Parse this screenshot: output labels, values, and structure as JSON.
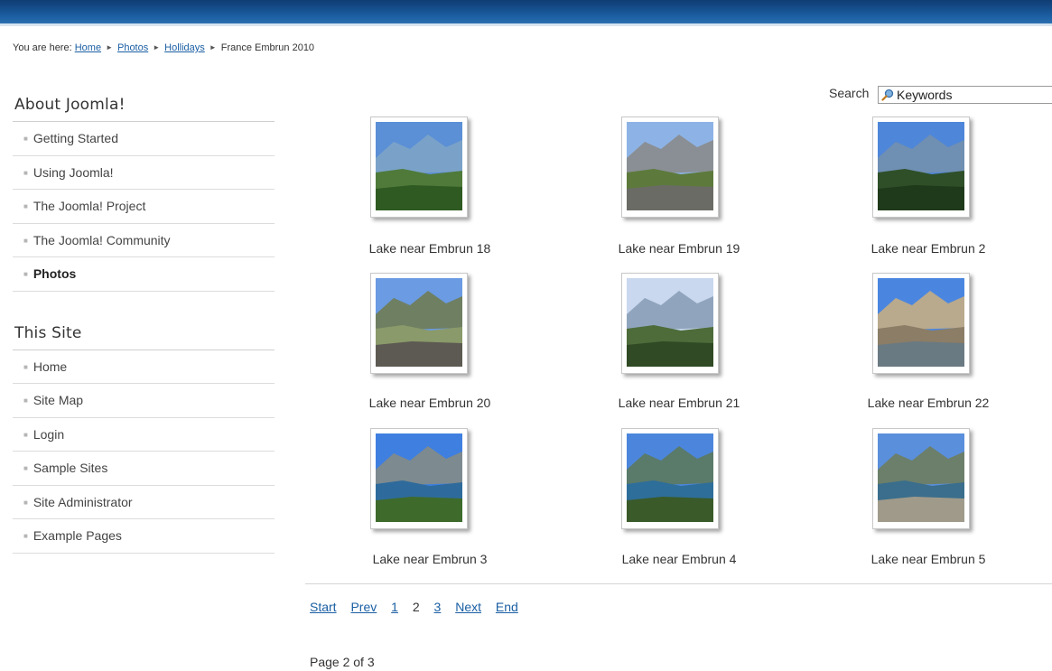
{
  "breadcrumb": {
    "prefix": "You are here:",
    "home": "Home",
    "photos": "Photos",
    "hollidays": "Hollidays",
    "current": "France Embrun 2010"
  },
  "menu_about": {
    "title": "About Joomla!",
    "items": [
      "Getting Started",
      "Using Joomla!",
      "The Joomla! Project",
      "The Joomla! Community",
      "Photos"
    ],
    "active_item": "Photos"
  },
  "menu_site": {
    "title": "This Site",
    "items": [
      "Home",
      "Site Map",
      "Login",
      "Sample Sites",
      "Site Administrator",
      "Example Pages"
    ]
  },
  "search": {
    "label": "Search",
    "placeholder": "Keywords"
  },
  "gallery": {
    "photos": [
      {
        "caption": "Lake near Embrun 18",
        "palette": [
          "#5b8fd6",
          "#7aa2c9",
          "#4f7a3a",
          "#2f5a22"
        ]
      },
      {
        "caption": "Lake near Embrun 19",
        "palette": [
          "#8db3e6",
          "#8a8f95",
          "#5d7a3c",
          "#6b6b66"
        ]
      },
      {
        "caption": "Lake near Embrun 2",
        "palette": [
          "#4e86d9",
          "#6f8fb3",
          "#2f4f28",
          "#1f3a1a"
        ]
      },
      {
        "caption": "Lake near Embrun 20",
        "palette": [
          "#6a9be3",
          "#6f7f62",
          "#8a9a6a",
          "#5c5a52"
        ]
      },
      {
        "caption": "Lake near Embrun 21",
        "palette": [
          "#c9d8ee",
          "#90a5bd",
          "#4d6c3a",
          "#2f4a24"
        ]
      },
      {
        "caption": "Lake near Embrun 22",
        "palette": [
          "#4a86e0",
          "#b9a98d",
          "#8b7d66",
          "#6a7a82"
        ]
      },
      {
        "caption": "Lake near Embrun 3",
        "palette": [
          "#3f7fe0",
          "#7d8a8f",
          "#2e6b9c",
          "#3e6a2c"
        ]
      },
      {
        "caption": "Lake near Embrun 4",
        "palette": [
          "#4c86dc",
          "#5a7a6a",
          "#2e6e9a",
          "#3a5a2a"
        ]
      },
      {
        "caption": "Lake near Embrun 5",
        "palette": [
          "#5a8fdc",
          "#6c7f6a",
          "#3a6e8c",
          "#a09a8a"
        ]
      }
    ]
  },
  "pagination": {
    "start": "Start",
    "prev": "Prev",
    "p1": "1",
    "p2": "2",
    "p3": "3",
    "next": "Next",
    "end": "End",
    "summary": "Page 2 of 3"
  }
}
